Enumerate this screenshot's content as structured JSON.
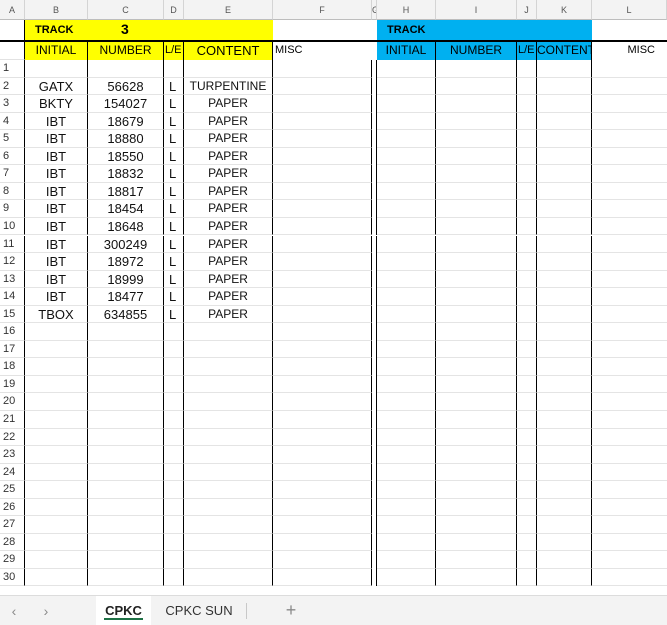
{
  "sheet": {
    "column_letters": [
      "A",
      "B",
      "C",
      "D",
      "E",
      "F",
      "G",
      "H",
      "I",
      "J",
      "K",
      "L"
    ],
    "track_left": {
      "label": "TRACK",
      "number": "3",
      "headers": [
        "INITIAL",
        "NUMBER",
        "L/E",
        "CONTENT"
      ],
      "misc_label": "MISC"
    },
    "track_right": {
      "label": "TRACK",
      "number": "",
      "headers": [
        "INITIAL",
        "NUMBER",
        "L/E",
        "CONTENT"
      ],
      "misc_label": "MISC"
    },
    "row_numbers": [
      "1",
      "2",
      "3",
      "4",
      "5",
      "6",
      "7",
      "8",
      "9",
      "10",
      "11",
      "12",
      "13",
      "14",
      "15",
      "16",
      "17",
      "18",
      "19",
      "20",
      "21",
      "22",
      "23",
      "24",
      "25",
      "26",
      "27",
      "28",
      "29",
      "30"
    ],
    "rows": [
      [
        "",
        "",
        "",
        ""
      ],
      [
        "GATX",
        "56628",
        "L",
        "TURPENTINE"
      ],
      [
        "BKTY",
        "154027",
        "L",
        "PAPER"
      ],
      [
        "IBT",
        "18679",
        "L",
        "PAPER"
      ],
      [
        "IBT",
        "18880",
        "L",
        "PAPER"
      ],
      [
        "IBT",
        "18550",
        "L",
        "PAPER"
      ],
      [
        "IBT",
        "18832",
        "L",
        "PAPER"
      ],
      [
        "IBT",
        "18817",
        "L",
        "PAPER"
      ],
      [
        "IBT",
        "18454",
        "L",
        "PAPER"
      ],
      [
        "IBT",
        "18648",
        "L",
        "PAPER"
      ],
      [
        "IBT",
        "300249",
        "L",
        "PAPER"
      ],
      [
        "IBT",
        "18972",
        "L",
        "PAPER"
      ],
      [
        "IBT",
        "18999",
        "L",
        "PAPER"
      ],
      [
        "IBT",
        "18477",
        "L",
        "PAPER"
      ],
      [
        "TBOX",
        "634855",
        "L",
        "PAPER"
      ]
    ]
  },
  "colors": {
    "left_header_fill": "#ffff00",
    "right_header_fill": "#00b0f0",
    "active_tab_underline": "#1e7145"
  },
  "tabs": [
    {
      "label": "CPKC",
      "active": true
    },
    {
      "label": "CPKC SUN",
      "active": false
    }
  ],
  "tab_nav": {
    "prev_icon": "chevron-left-icon",
    "next_icon": "chevron-right-icon",
    "add_icon": "plus-icon"
  }
}
